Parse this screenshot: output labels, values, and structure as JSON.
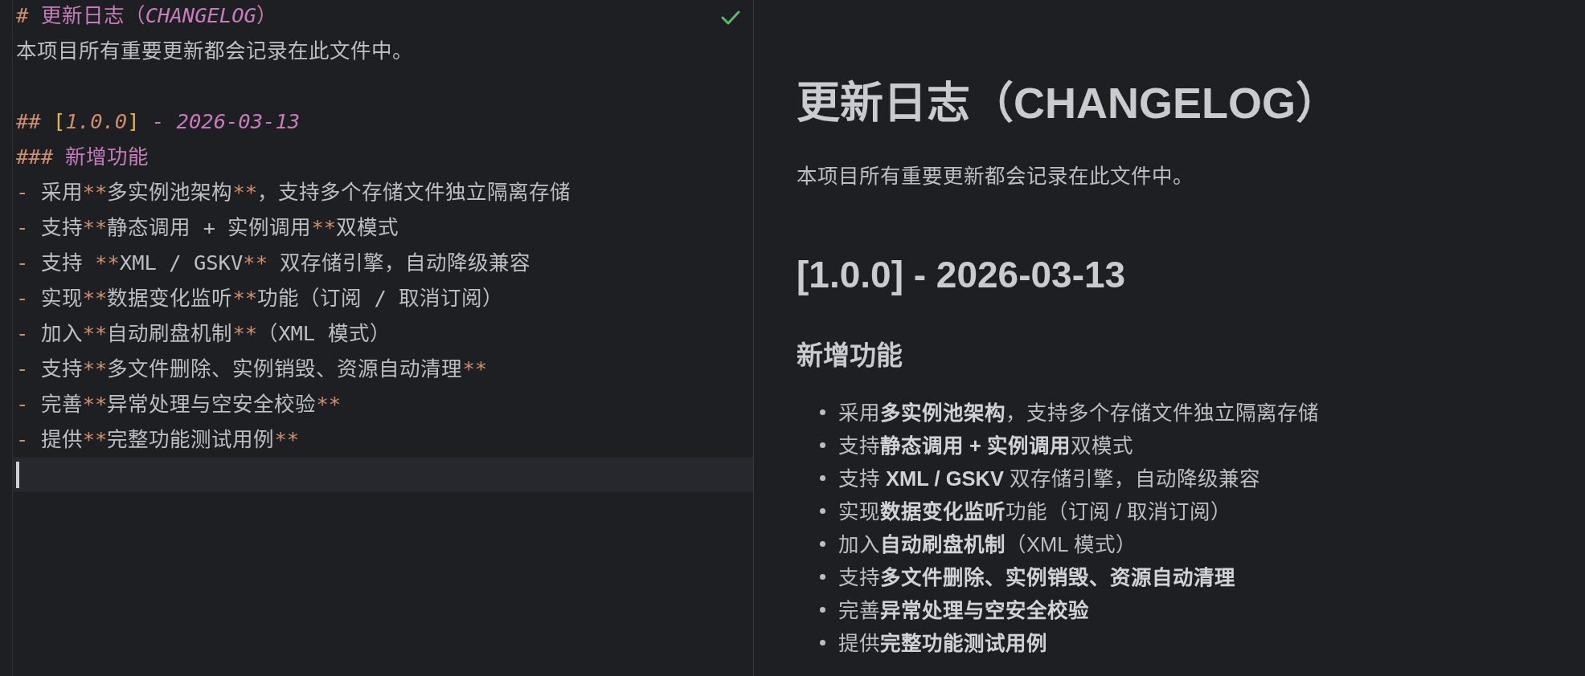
{
  "editor": {
    "lines": [
      {
        "current": false,
        "tokens": [
          {
            "kind": "markup",
            "text": "# "
          },
          {
            "kind": "heading",
            "text": "更新日志（"
          },
          {
            "kind": "emphasis",
            "text": "CHANGELOG"
          },
          {
            "kind": "heading",
            "text": "）"
          }
        ]
      },
      {
        "current": false,
        "tokens": [
          {
            "kind": "text",
            "text": "本项目所有重要更新都会记录在此文件中。"
          }
        ]
      },
      {
        "current": false
      },
      {
        "current": false,
        "tokens": [
          {
            "kind": "markup",
            "text": "## "
          },
          {
            "kind": "bracket",
            "text": "["
          },
          {
            "kind": "version",
            "text": "1.0.0"
          },
          {
            "kind": "bracket",
            "text": "]"
          },
          {
            "kind": "emphasis",
            "text": " - 2026-03-13"
          }
        ]
      },
      {
        "current": false,
        "tokens": [
          {
            "kind": "markup",
            "text": "### "
          },
          {
            "kind": "heading",
            "text": "新增功能"
          }
        ]
      },
      {
        "current": false,
        "tokens": [
          {
            "kind": "markup",
            "text": "- "
          },
          {
            "kind": "text",
            "text": "采用"
          },
          {
            "kind": "markup",
            "text": "**"
          },
          {
            "kind": "text",
            "text": "多实例池架构"
          },
          {
            "kind": "markup",
            "text": "**"
          },
          {
            "kind": "text",
            "text": "，支持多个存储文件独立隔离存储"
          }
        ]
      },
      {
        "current": false,
        "tokens": [
          {
            "kind": "markup",
            "text": "- "
          },
          {
            "kind": "text",
            "text": "支持"
          },
          {
            "kind": "markup",
            "text": "**"
          },
          {
            "kind": "text",
            "text": "静态调用 + 实例调用"
          },
          {
            "kind": "markup",
            "text": "**"
          },
          {
            "kind": "text",
            "text": "双模式"
          }
        ]
      },
      {
        "current": false,
        "tokens": [
          {
            "kind": "markup",
            "text": "- "
          },
          {
            "kind": "text",
            "text": "支持 "
          },
          {
            "kind": "markup",
            "text": "**"
          },
          {
            "kind": "text",
            "text": "XML / GSKV"
          },
          {
            "kind": "markup",
            "text": "**"
          },
          {
            "kind": "text",
            "text": " 双存储引擎，自动降级兼容"
          }
        ]
      },
      {
        "current": false,
        "tokens": [
          {
            "kind": "markup",
            "text": "- "
          },
          {
            "kind": "text",
            "text": "实现"
          },
          {
            "kind": "markup",
            "text": "**"
          },
          {
            "kind": "text",
            "text": "数据变化监听"
          },
          {
            "kind": "markup",
            "text": "**"
          },
          {
            "kind": "text",
            "text": "功能（订阅 / 取消订阅）"
          }
        ]
      },
      {
        "current": false,
        "tokens": [
          {
            "kind": "markup",
            "text": "- "
          },
          {
            "kind": "text",
            "text": "加入"
          },
          {
            "kind": "markup",
            "text": "**"
          },
          {
            "kind": "text",
            "text": "自动刷盘机制"
          },
          {
            "kind": "markup",
            "text": "**"
          },
          {
            "kind": "text",
            "text": "（XML 模式）"
          }
        ]
      },
      {
        "current": false,
        "tokens": [
          {
            "kind": "markup",
            "text": "- "
          },
          {
            "kind": "text",
            "text": "支持"
          },
          {
            "kind": "markup",
            "text": "**"
          },
          {
            "kind": "text",
            "text": "多文件删除、实例销毁、资源自动清理"
          },
          {
            "kind": "markup",
            "text": "**"
          }
        ]
      },
      {
        "current": false,
        "tokens": [
          {
            "kind": "markup",
            "text": "- "
          },
          {
            "kind": "text",
            "text": "完善"
          },
          {
            "kind": "markup",
            "text": "**"
          },
          {
            "kind": "text",
            "text": "异常处理与空安全校验"
          },
          {
            "kind": "markup",
            "text": "**"
          }
        ]
      },
      {
        "current": false,
        "tokens": [
          {
            "kind": "markup",
            "text": "- "
          },
          {
            "kind": "text",
            "text": "提供"
          },
          {
            "kind": "markup",
            "text": "**"
          },
          {
            "kind": "text",
            "text": "完整功能测试用例"
          },
          {
            "kind": "markup",
            "text": "**"
          }
        ]
      },
      {
        "current": true
      }
    ]
  },
  "preview": {
    "title": "更新日志（CHANGELOG）",
    "intro": "本项目所有重要更新都会记录在此文件中。",
    "version_heading": "[1.0.0] - 2026-03-13",
    "section_heading": "新增功能",
    "items": [
      "采用**多实例池架构**，支持多个存储文件独立隔离存储",
      "支持**静态调用 + 实例调用**双模式",
      "支持 **XML / GSKV** 双存储引擎，自动降级兼容",
      "实现**数据变化监听**功能（订阅 / 取消订阅）",
      "加入**自动刷盘机制**（XML 模式）",
      "支持**多文件删除、实例销毁、资源自动清理**",
      "完善**异常处理与空安全校验**",
      "提供**完整功能测试用例**"
    ]
  }
}
